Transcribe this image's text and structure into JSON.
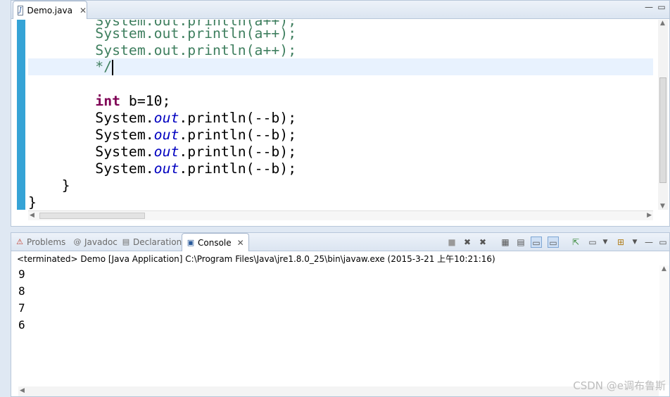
{
  "editor": {
    "tab_label": "Demo.java",
    "tab_icon": "java-file-icon",
    "lines": [
      {
        "indent": "        ",
        "text": "System.out.println(a++);",
        "kind": "comment-partial"
      },
      {
        "indent": "        ",
        "text": "System.out.println(a++);",
        "kind": "comment"
      },
      {
        "indent": "        ",
        "text": "System.out.println(a++);",
        "kind": "comment"
      },
      {
        "indent": "        ",
        "text": "*/",
        "kind": "comment"
      },
      {
        "indent": "",
        "text": "",
        "kind": "blank"
      },
      {
        "indent": "        ",
        "keyword": "int",
        "text": " b=10;",
        "kind": "decl"
      },
      {
        "indent": "        ",
        "prefix": "System.",
        "field": "out",
        "suffix": ".println(--b);",
        "kind": "call"
      },
      {
        "indent": "        ",
        "prefix": "System.",
        "field": "out",
        "suffix": ".println(--b);",
        "kind": "call"
      },
      {
        "indent": "        ",
        "prefix": "System.",
        "field": "out",
        "suffix": ".println(--b);",
        "kind": "call"
      },
      {
        "indent": "        ",
        "prefix": "System.",
        "field": "out",
        "suffix": ".println(--b);",
        "kind": "call"
      },
      {
        "indent": "    ",
        "text": "}",
        "kind": "plain"
      },
      {
        "indent": "",
        "text": "}",
        "kind": "plain"
      }
    ],
    "colors": {
      "comment": "#3f7f5f",
      "keyword": "#7f0055",
      "field": "#0000c0",
      "ruler": "#35a3d6"
    }
  },
  "views": {
    "tabs": [
      {
        "label": "Problems",
        "icon": "problems-icon"
      },
      {
        "label": "Javadoc",
        "icon": "at-sign-icon"
      },
      {
        "label": "Declaration",
        "icon": "declaration-icon"
      },
      {
        "label": "Console",
        "icon": "console-icon"
      }
    ],
    "active_tab": "Console"
  },
  "console": {
    "header": "<terminated> Demo [Java Application] C:\\Program Files\\Java\\jre1.8.0_25\\bin\\javaw.exe (2015-3-21 上午10:21:16)",
    "output": [
      "9",
      "8",
      "7",
      "6"
    ]
  },
  "watermark": "CSDN @e调布鲁斯"
}
